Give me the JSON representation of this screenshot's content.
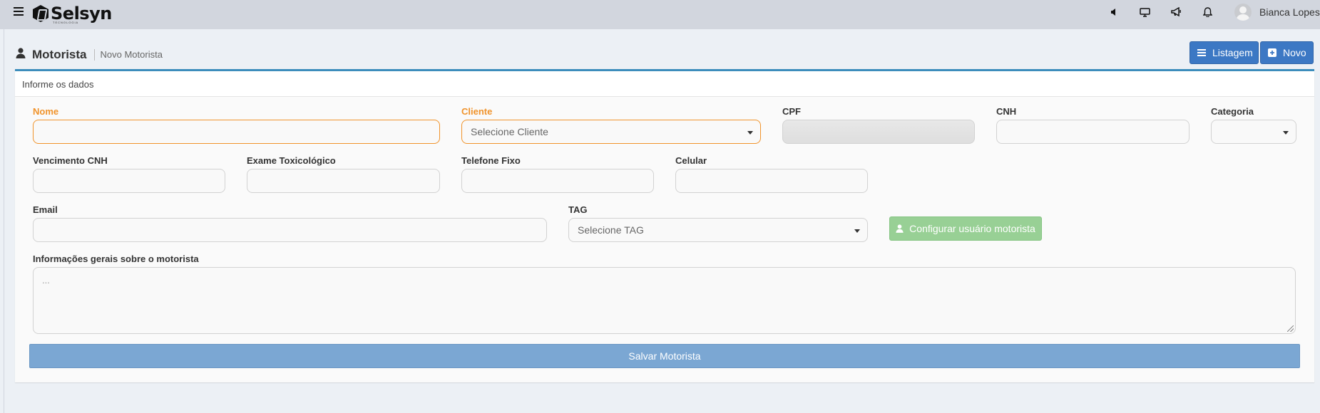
{
  "navbar": {
    "brand": "Selsyn",
    "brand_tagline": "TECNOLOGIA",
    "icons": [
      "volume-icon",
      "monitor-icon",
      "megaphone-icon",
      "bell-icon"
    ],
    "user_name": "Bianca Lopes"
  },
  "page": {
    "title": "Motorista",
    "subtitle": "Novo Motorista",
    "list_button": "Listagem",
    "new_button": "Novo"
  },
  "form": {
    "box_title": "Informe os dados",
    "fields": {
      "nome": {
        "label": "Nome",
        "value": ""
      },
      "cliente": {
        "label": "Cliente",
        "placeholder": "Selecione Cliente"
      },
      "cpf": {
        "label": "CPF",
        "value": ""
      },
      "cnh": {
        "label": "CNH",
        "value": ""
      },
      "categoria": {
        "label": "Categoria",
        "value": ""
      },
      "vencimento_cnh": {
        "label": "Vencimento CNH",
        "value": ""
      },
      "exame_toxicologico": {
        "label": "Exame Toxicológico",
        "value": ""
      },
      "telefone_fixo": {
        "label": "Telefone Fixo",
        "value": ""
      },
      "celular": {
        "label": "Celular",
        "value": ""
      },
      "email": {
        "label": "Email",
        "value": ""
      },
      "tag": {
        "label": "TAG",
        "placeholder": "Selecione TAG"
      },
      "informacoes": {
        "label": "Informações gerais sobre o motorista",
        "placeholder": "..."
      }
    },
    "configure_user_button": "Configurar usuário motorista",
    "save_button": "Salvar Motorista"
  },
  "colors": {
    "navbar_bg": "#d2d6de",
    "page_bg": "#ecf0f5",
    "primary": "#3c78c4",
    "required_label": "#f0932b",
    "success_disabled": "#98d095",
    "save_button": "#7ba7d3"
  }
}
